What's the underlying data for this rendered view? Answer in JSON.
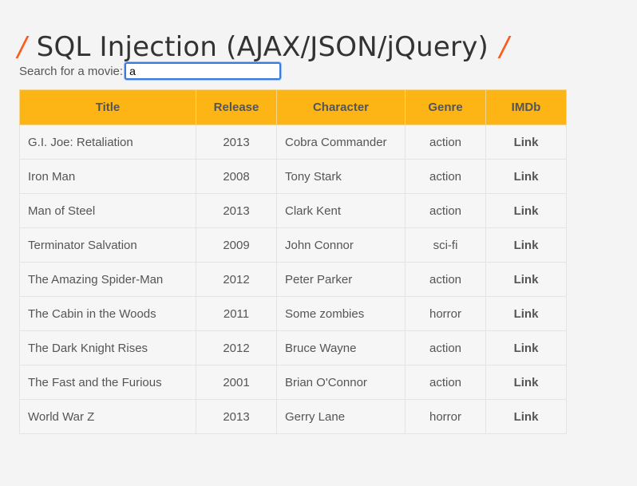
{
  "header": {
    "slash_left": "/",
    "title": "SQL Injection (AJAX/JSON/jQuery)",
    "slash_right": "/",
    "accent_color": "#ff5a1e"
  },
  "search": {
    "label": "Search for a movie:",
    "value": "a"
  },
  "table": {
    "header_color": "#fdb515",
    "columns": [
      "Title",
      "Release",
      "Character",
      "Genre",
      "IMDb"
    ],
    "rows": [
      {
        "title": "G.I. Joe: Retaliation",
        "release": "2013",
        "character": "Cobra Commander",
        "genre": "action",
        "imdb": "Link"
      },
      {
        "title": "Iron Man",
        "release": "2008",
        "character": "Tony Stark",
        "genre": "action",
        "imdb": "Link"
      },
      {
        "title": "Man of Steel",
        "release": "2013",
        "character": "Clark Kent",
        "genre": "action",
        "imdb": "Link"
      },
      {
        "title": "Terminator Salvation",
        "release": "2009",
        "character": "John Connor",
        "genre": "sci-fi",
        "imdb": "Link"
      },
      {
        "title": "The Amazing Spider-Man",
        "release": "2012",
        "character": "Peter Parker",
        "genre": "action",
        "imdb": "Link"
      },
      {
        "title": "The Cabin in the Woods",
        "release": "2011",
        "character": "Some zombies",
        "genre": "horror",
        "imdb": "Link"
      },
      {
        "title": "The Dark Knight Rises",
        "release": "2012",
        "character": "Bruce Wayne",
        "genre": "action",
        "imdb": "Link"
      },
      {
        "title": "The Fast and the Furious",
        "release": "2001",
        "character": "Brian O'Connor",
        "genre": "action",
        "imdb": "Link"
      },
      {
        "title": "World War Z",
        "release": "2013",
        "character": "Gerry Lane",
        "genre": "horror",
        "imdb": "Link"
      }
    ]
  }
}
